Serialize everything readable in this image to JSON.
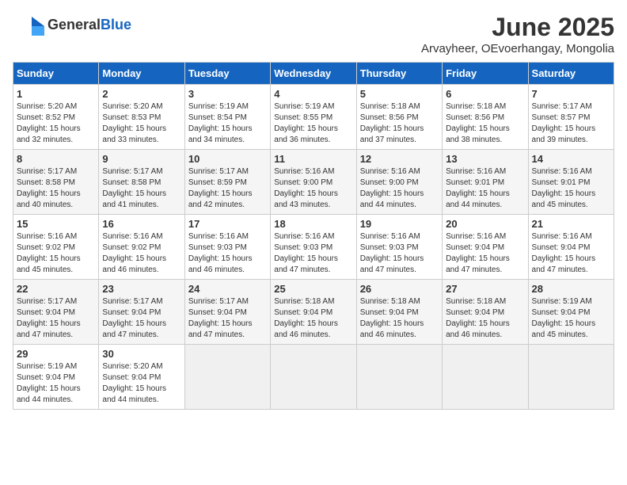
{
  "logo": {
    "general": "General",
    "blue": "Blue"
  },
  "title": "June 2025",
  "subtitle": "Arvayheer, OEvoerhangay, Mongolia",
  "days_header": [
    "Sunday",
    "Monday",
    "Tuesday",
    "Wednesday",
    "Thursday",
    "Friday",
    "Saturday"
  ],
  "weeks": [
    [
      {
        "day": "1",
        "sunrise": "Sunrise: 5:20 AM",
        "sunset": "Sunset: 8:52 PM",
        "daylight": "Daylight: 15 hours and 32 minutes."
      },
      {
        "day": "2",
        "sunrise": "Sunrise: 5:20 AM",
        "sunset": "Sunset: 8:53 PM",
        "daylight": "Daylight: 15 hours and 33 minutes."
      },
      {
        "day": "3",
        "sunrise": "Sunrise: 5:19 AM",
        "sunset": "Sunset: 8:54 PM",
        "daylight": "Daylight: 15 hours and 34 minutes."
      },
      {
        "day": "4",
        "sunrise": "Sunrise: 5:19 AM",
        "sunset": "Sunset: 8:55 PM",
        "daylight": "Daylight: 15 hours and 36 minutes."
      },
      {
        "day": "5",
        "sunrise": "Sunrise: 5:18 AM",
        "sunset": "Sunset: 8:56 PM",
        "daylight": "Daylight: 15 hours and 37 minutes."
      },
      {
        "day": "6",
        "sunrise": "Sunrise: 5:18 AM",
        "sunset": "Sunset: 8:56 PM",
        "daylight": "Daylight: 15 hours and 38 minutes."
      },
      {
        "day": "7",
        "sunrise": "Sunrise: 5:17 AM",
        "sunset": "Sunset: 8:57 PM",
        "daylight": "Daylight: 15 hours and 39 minutes."
      }
    ],
    [
      {
        "day": "8",
        "sunrise": "Sunrise: 5:17 AM",
        "sunset": "Sunset: 8:58 PM",
        "daylight": "Daylight: 15 hours and 40 minutes."
      },
      {
        "day": "9",
        "sunrise": "Sunrise: 5:17 AM",
        "sunset": "Sunset: 8:58 PM",
        "daylight": "Daylight: 15 hours and 41 minutes."
      },
      {
        "day": "10",
        "sunrise": "Sunrise: 5:17 AM",
        "sunset": "Sunset: 8:59 PM",
        "daylight": "Daylight: 15 hours and 42 minutes."
      },
      {
        "day": "11",
        "sunrise": "Sunrise: 5:16 AM",
        "sunset": "Sunset: 9:00 PM",
        "daylight": "Daylight: 15 hours and 43 minutes."
      },
      {
        "day": "12",
        "sunrise": "Sunrise: 5:16 AM",
        "sunset": "Sunset: 9:00 PM",
        "daylight": "Daylight: 15 hours and 44 minutes."
      },
      {
        "day": "13",
        "sunrise": "Sunrise: 5:16 AM",
        "sunset": "Sunset: 9:01 PM",
        "daylight": "Daylight: 15 hours and 44 minutes."
      },
      {
        "day": "14",
        "sunrise": "Sunrise: 5:16 AM",
        "sunset": "Sunset: 9:01 PM",
        "daylight": "Daylight: 15 hours and 45 minutes."
      }
    ],
    [
      {
        "day": "15",
        "sunrise": "Sunrise: 5:16 AM",
        "sunset": "Sunset: 9:02 PM",
        "daylight": "Daylight: 15 hours and 45 minutes."
      },
      {
        "day": "16",
        "sunrise": "Sunrise: 5:16 AM",
        "sunset": "Sunset: 9:02 PM",
        "daylight": "Daylight: 15 hours and 46 minutes."
      },
      {
        "day": "17",
        "sunrise": "Sunrise: 5:16 AM",
        "sunset": "Sunset: 9:03 PM",
        "daylight": "Daylight: 15 hours and 46 minutes."
      },
      {
        "day": "18",
        "sunrise": "Sunrise: 5:16 AM",
        "sunset": "Sunset: 9:03 PM",
        "daylight": "Daylight: 15 hours and 47 minutes."
      },
      {
        "day": "19",
        "sunrise": "Sunrise: 5:16 AM",
        "sunset": "Sunset: 9:03 PM",
        "daylight": "Daylight: 15 hours and 47 minutes."
      },
      {
        "day": "20",
        "sunrise": "Sunrise: 5:16 AM",
        "sunset": "Sunset: 9:04 PM",
        "daylight": "Daylight: 15 hours and 47 minutes."
      },
      {
        "day": "21",
        "sunrise": "Sunrise: 5:16 AM",
        "sunset": "Sunset: 9:04 PM",
        "daylight": "Daylight: 15 hours and 47 minutes."
      }
    ],
    [
      {
        "day": "22",
        "sunrise": "Sunrise: 5:17 AM",
        "sunset": "Sunset: 9:04 PM",
        "daylight": "Daylight: 15 hours and 47 minutes."
      },
      {
        "day": "23",
        "sunrise": "Sunrise: 5:17 AM",
        "sunset": "Sunset: 9:04 PM",
        "daylight": "Daylight: 15 hours and 47 minutes."
      },
      {
        "day": "24",
        "sunrise": "Sunrise: 5:17 AM",
        "sunset": "Sunset: 9:04 PM",
        "daylight": "Daylight: 15 hours and 47 minutes."
      },
      {
        "day": "25",
        "sunrise": "Sunrise: 5:18 AM",
        "sunset": "Sunset: 9:04 PM",
        "daylight": "Daylight: 15 hours and 46 minutes."
      },
      {
        "day": "26",
        "sunrise": "Sunrise: 5:18 AM",
        "sunset": "Sunset: 9:04 PM",
        "daylight": "Daylight: 15 hours and 46 minutes."
      },
      {
        "day": "27",
        "sunrise": "Sunrise: 5:18 AM",
        "sunset": "Sunset: 9:04 PM",
        "daylight": "Daylight: 15 hours and 46 minutes."
      },
      {
        "day": "28",
        "sunrise": "Sunrise: 5:19 AM",
        "sunset": "Sunset: 9:04 PM",
        "daylight": "Daylight: 15 hours and 45 minutes."
      }
    ],
    [
      {
        "day": "29",
        "sunrise": "Sunrise: 5:19 AM",
        "sunset": "Sunset: 9:04 PM",
        "daylight": "Daylight: 15 hours and 44 minutes."
      },
      {
        "day": "30",
        "sunrise": "Sunrise: 5:20 AM",
        "sunset": "Sunset: 9:04 PM",
        "daylight": "Daylight: 15 hours and 44 minutes."
      },
      null,
      null,
      null,
      null,
      null
    ]
  ]
}
